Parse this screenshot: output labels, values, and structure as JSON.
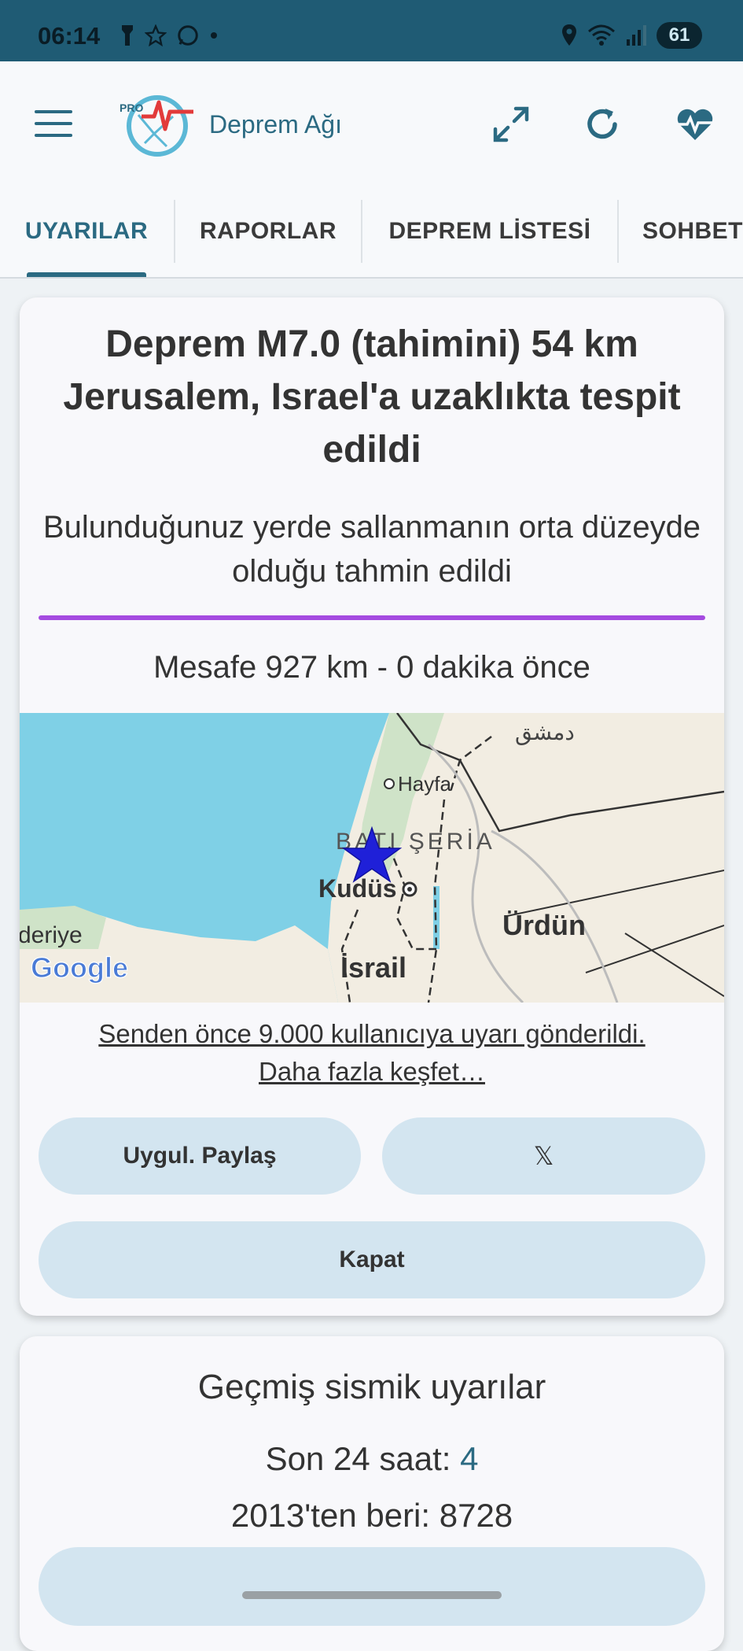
{
  "status_bar": {
    "time": "06:14",
    "battery": "61"
  },
  "header": {
    "app_name": "Deprem Ağı",
    "logo_badge": "PRO"
  },
  "tabs": [
    {
      "label": "UYARILAR"
    },
    {
      "label": "RAPORLAR"
    },
    {
      "label": "DEPREM LİSTESİ"
    },
    {
      "label": "SOHBET"
    }
  ],
  "alert": {
    "title": "Deprem M7.0 (tahimini) 54 km Jerusalem, Israel'a uzaklıkta tespit edildi",
    "subtitle": "Bulunduğunuz yerde sallanmanın orta düzeyde olduğu tahmin edildi",
    "intensity_color": "#a54be0",
    "distance": "Mesafe 927 km - 0 dakika önce",
    "map_labels": {
      "damascus": "دمشق",
      "haifa": "Hayfa",
      "west_bank": "BATI ŞERİA",
      "jerusalem": "Kudüs",
      "jordan": "Ürdün",
      "israel": "İsrail",
      "alexandria": "deriye",
      "google": "Google"
    },
    "link_line1": "Senden önce 9.000 kullanıcıya uyarı gönderildi.",
    "link_line2": "Daha fazla keşfet…",
    "share_button": "Uygul. Paylaş",
    "x_button": "𝕏",
    "close_button": "Kapat"
  },
  "history": {
    "title": "Geçmiş sismik uyarılar",
    "last24_label": "Son 24 saat: ",
    "last24_value": "4",
    "since2013": "2013'ten beri: 8728"
  },
  "colors": {
    "accent": "#2b6a82",
    "status_bar": "#1f5b74",
    "pill": "#d3e5f0"
  }
}
